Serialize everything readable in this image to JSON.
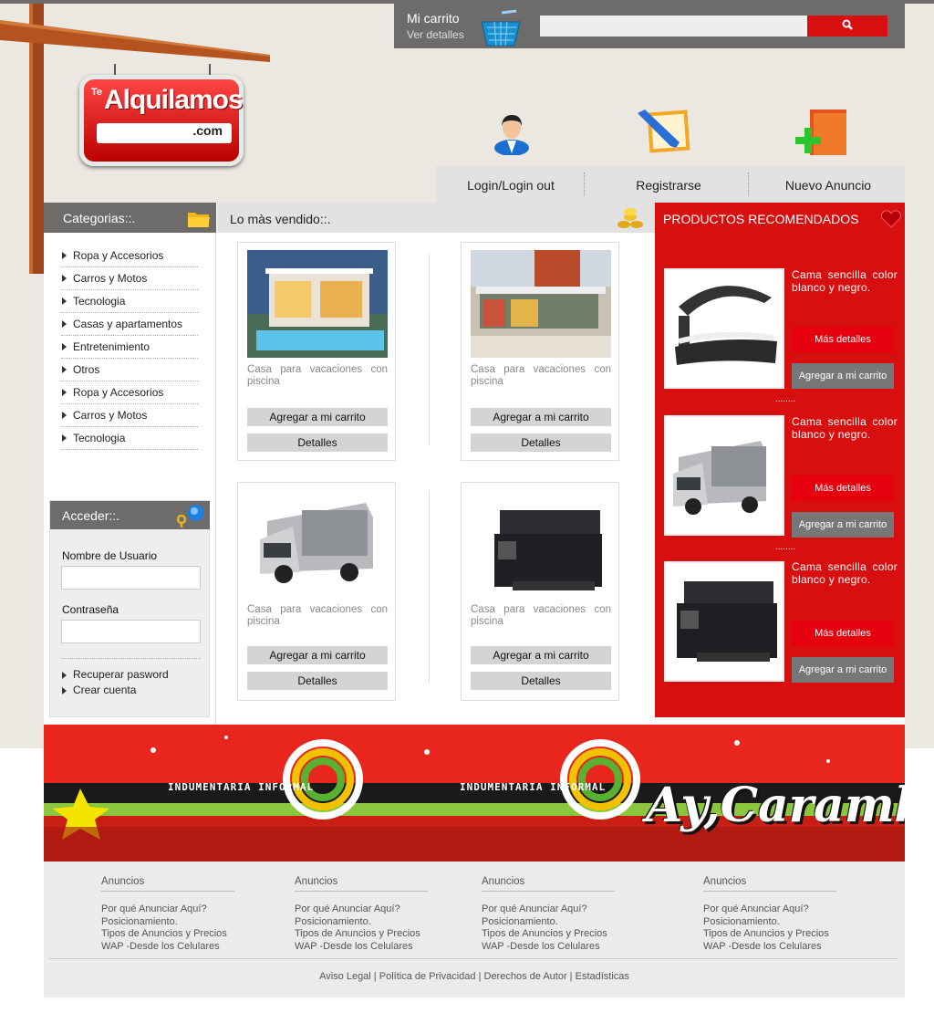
{
  "colors": {
    "accent": "#d70f0f",
    "dark_gray": "#6e6c6b",
    "light_gray": "#e2e2e2"
  },
  "header": {
    "cart": {
      "title": "Mi carrito",
      "subtitle": "Ver detalles",
      "icon": "shopping-basket-icon"
    },
    "search": {
      "value": "",
      "placeholder": "",
      "icon": "search-icon"
    },
    "logo": {
      "prefix": "Te",
      "brand": "Alquilamos",
      "domain": ".com"
    }
  },
  "nav": {
    "items": [
      {
        "label": "Login/Login out",
        "icon": "user-icon"
      },
      {
        "label": "Registrarse",
        "icon": "notebook-pencil-icon"
      },
      {
        "label": "Nuevo Anuncio",
        "icon": "add-document-icon"
      }
    ]
  },
  "categories": {
    "title": "Categorias::.",
    "items": [
      "Ropa y Accesorios",
      "Carros y Motos",
      "Tecnologia",
      "Casas y apartamentos",
      "Entretenimiento",
      "Otros",
      "Ropa y Accesorios",
      "Carros y Motos",
      "Tecnologia"
    ]
  },
  "login": {
    "title": "Acceder::.",
    "username_label": "Nombre de Usuario",
    "password_label": "Contraseña",
    "username_value": "",
    "password_value": "",
    "links": [
      "Recuperar pasword",
      "Crear cuenta"
    ]
  },
  "bestsellers": {
    "title": "Lo màs vendido::.",
    "products": [
      {
        "image": "modern-house-pool",
        "desc_line1": "Casa para vacaciones con",
        "desc_line2": "piscina",
        "cart_label": "Agregar a mi carrito",
        "details_label": "Detalles"
      },
      {
        "image": "building-courtyard",
        "desc_line1": "Casa para vacaciones con",
        "desc_line2": "piscina",
        "cart_label": "Agregar a mi carrito",
        "details_label": "Detalles"
      },
      {
        "image": "camper-van",
        "desc_line1": "Casa para vacaciones con",
        "desc_line2": "piscina",
        "cart_label": "Agregar a mi carrito",
        "details_label": "Detalles"
      },
      {
        "image": "printer",
        "desc_line1": "Casa para vacaciones con",
        "desc_line2": "piscina",
        "cart_label": "Agregar a mi carrito",
        "details_label": "Detalles"
      }
    ]
  },
  "recommended": {
    "title": "PRODUCTOS RECOMENDADOS",
    "items": [
      {
        "image": "lounge-bed",
        "line1": "Cama sencilla color",
        "line2": "blanco y negro.",
        "more_label": "Más detalles",
        "cart_label": "Agregar a mi carrito"
      },
      {
        "image": "camper-van",
        "line1": "Cama sencilla color",
        "line2": "blanco y negro.",
        "more_label": "Más detalles",
        "cart_label": "Agregar a mi carrito"
      },
      {
        "image": "printer",
        "line1": "Cama sencilla color",
        "line2": "blanco y negro.",
        "more_label": "Más detalles",
        "cart_label": "Agregar a mi carrito"
      }
    ],
    "separator": "........"
  },
  "banner": {
    "tagline": "INDUMENTARIA INFORMAL",
    "brand": "Ay,Caramba"
  },
  "footer": {
    "columns": [
      {
        "heading": "Anuncios",
        "links": [
          "Por qué Anunciar Aquí?",
          "Posicionamiento.",
          "Tipos de Anuncios y Precios",
          "WAP -Desde los Celulares"
        ]
      },
      {
        "heading": "Anuncios",
        "links": [
          "Por qué Anunciar Aquí?",
          "Posicionamiento.",
          "Tipos de Anuncios y Precios",
          "WAP -Desde los Celulares"
        ]
      },
      {
        "heading": "Anuncios",
        "links": [
          "Por qué Anunciar Aquí?",
          "Posicionamiento.",
          "Tipos de Anuncios y Precios",
          "WAP -Desde los Celulares"
        ]
      },
      {
        "heading": "Anuncios",
        "links": [
          "Por qué Anunciar Aquí?",
          "Posicionamiento.",
          "Tipos de Anuncios y Precios",
          "WAP -Desde los Celulares"
        ]
      }
    ],
    "legal": [
      "Aviso Legal",
      "Política de Privacidad",
      "Derechos de Autor",
      "Estadísticas"
    ]
  }
}
